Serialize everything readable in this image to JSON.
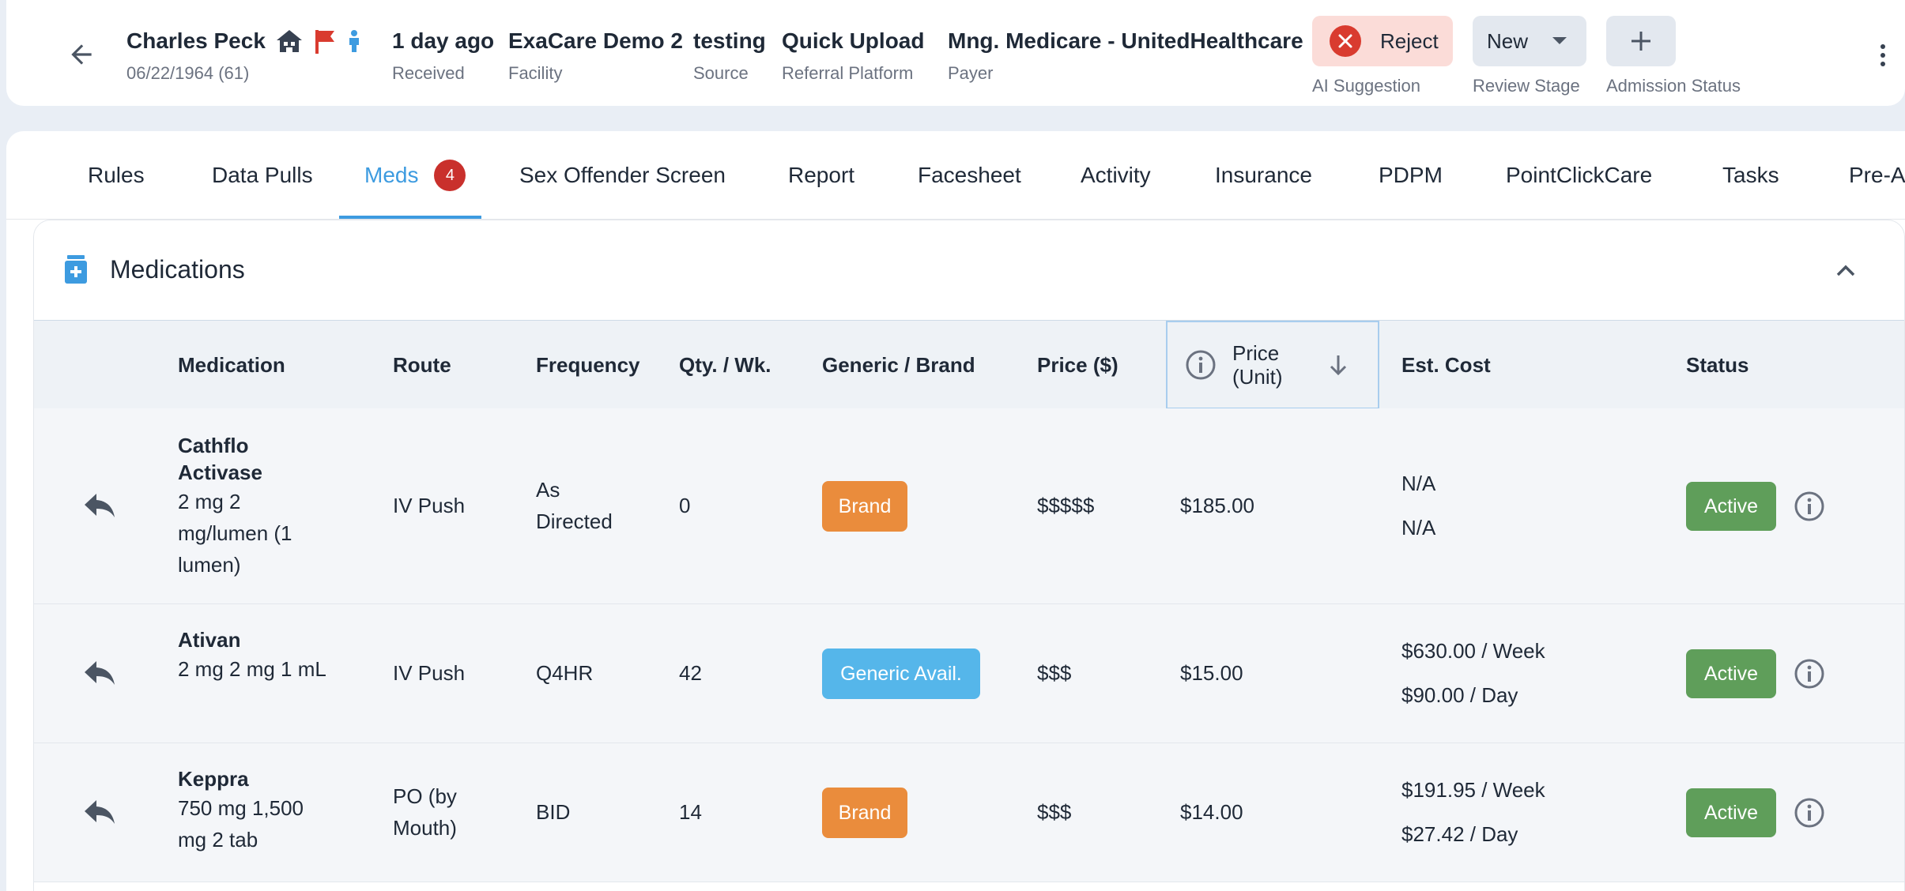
{
  "header": {
    "patient": {
      "name": "Charles Peck",
      "dob": "06/22/1964 (61)"
    },
    "meta": [
      {
        "value": "1 day ago",
        "label": "Received"
      },
      {
        "value": "ExaCare Demo 2",
        "label": "Facility"
      },
      {
        "value": "testing",
        "label": "Source"
      },
      {
        "value": "Quick Upload",
        "label": "Referral Platform"
      },
      {
        "value": "Mng. Medicare - UnitedHealthcare",
        "label": "Payer"
      }
    ],
    "ai_suggestion": {
      "button": "Reject",
      "label": "AI Suggestion"
    },
    "review_stage": {
      "value": "New",
      "label": "Review Stage"
    },
    "admission_status": {
      "label": "Admission Status"
    },
    "colors": {
      "flag": "#d93b2f",
      "person": "#3d9be0",
      "house": "#374151"
    }
  },
  "tabs": [
    {
      "label": "Rules"
    },
    {
      "label": "Data Pulls"
    },
    {
      "label": "Meds",
      "badge": "4",
      "active": true
    },
    {
      "label": "Sex Offender Screen"
    },
    {
      "label": "Report"
    },
    {
      "label": "Facesheet"
    },
    {
      "label": "Activity"
    },
    {
      "label": "Insurance"
    },
    {
      "label": "PDPM"
    },
    {
      "label": "PointClickCare"
    },
    {
      "label": "Tasks"
    },
    {
      "label": "Pre-A"
    }
  ],
  "medications": {
    "title": "Medications",
    "columns": {
      "medication": "Medication",
      "route": "Route",
      "frequency": "Frequency",
      "qty": "Qty. / Wk.",
      "generic_brand": "Generic / Brand",
      "price": "Price ($)",
      "price_unit": "Price (Unit)",
      "est_cost": "Est. Cost",
      "status": "Status"
    },
    "rows": [
      {
        "name": "Cathflo Activase",
        "dose": "2 mg 2 mg/lumen (1 lumen)",
        "route": "IV Push",
        "frequency": "As Directed",
        "qty": "0",
        "tag": "Brand",
        "price": "$$$$$",
        "unit_price": "$185.00",
        "cost_week": "N/A",
        "cost_day": "N/A",
        "status": "Active"
      },
      {
        "name": "Ativan",
        "dose": "2 mg 2 mg 1 mL",
        "route": "IV Push",
        "frequency": "Q4HR",
        "qty": "42",
        "tag": "Generic Avail.",
        "price": "$$$",
        "unit_price": "$15.00",
        "cost_week": "$630.00 / Week",
        "cost_day": "$90.00 / Day",
        "status": "Active"
      },
      {
        "name": "Keppra",
        "dose": "750 mg 1,500 mg 2 tab",
        "route": "PO (by Mouth)",
        "frequency": "BID",
        "qty": "14",
        "tag": "Brand",
        "price": "$$$",
        "unit_price": "$14.00",
        "cost_week": "$191.95 / Week",
        "cost_day": "$27.42 / Day",
        "status": "Active"
      }
    ],
    "colors": {
      "brand": "#ea8c3c",
      "generic": "#55b6ea",
      "active": "#5f9e5a",
      "tab_active": "#3d9be0"
    }
  }
}
